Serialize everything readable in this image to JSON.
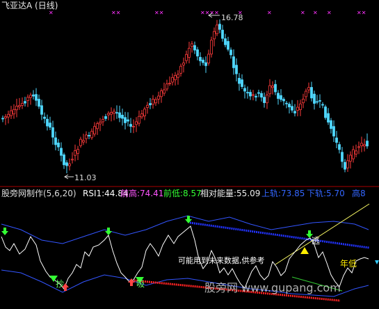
{
  "window": {
    "title": "飞亚达A (日线)"
  },
  "upper_chart": {
    "max_label": "16.78",
    "min_label": "11.03",
    "marker_glyph": "✕✕",
    "colors": {
      "up": "#ff3b3b",
      "down": "#4fd8ff",
      "marker": "#ff33ff"
    }
  },
  "indicator_header": {
    "name": "股旁网制作(5,6,20)",
    "rsi": "RSI1:44.84",
    "qian_gao": "前高:74.41",
    "qian_di": "前低:8.57",
    "xiangdui": "相对能量:55.09",
    "shang_gui": "上轨:73.85",
    "xia_gui": "下轨:5.70",
    "gao_di": "高8"
  },
  "lower_chart": {
    "label_tao": "逃",
    "label_chao": "抄",
    "label_xi": "吸",
    "label_niandi": "年低",
    "notice": "可能用到未来数据,供参考",
    "watermark": "股旁网  www.gupang.com",
    "colors": {
      "rsi_line": "#ffffff",
      "band": "#3355ff",
      "upper_trend": "#2233ff",
      "lower_trend": "#ff2222",
      "sell_arrow": "#33ff33",
      "buy_arrow": "#ff4444",
      "yellow": "#ffee00"
    }
  }
}
